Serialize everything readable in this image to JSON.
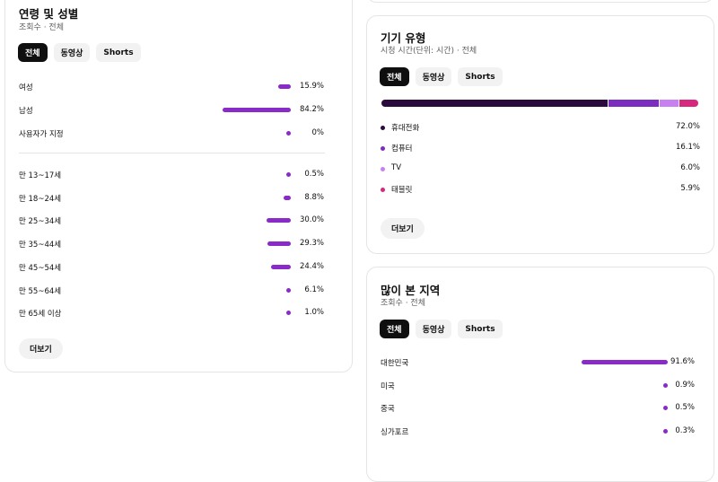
{
  "age_gender": {
    "title": "연령 및 성별",
    "subtitle": "조회수 · 전체",
    "chips": [
      "전체",
      "동영상",
      "Shorts"
    ],
    "gender_rows": [
      {
        "label": "여성",
        "value": "15.9%",
        "fraction": 0.159
      },
      {
        "label": "남성",
        "value": "84.2%",
        "fraction": 0.842
      },
      {
        "label": "사용자가 지정",
        "value": "0%",
        "fraction": 0.0
      }
    ],
    "age_rows": [
      {
        "label": "만 13~17세",
        "value": "0.5%",
        "fraction": 0.005
      },
      {
        "label": "만 18~24세",
        "value": "8.8%",
        "fraction": 0.088
      },
      {
        "label": "만 25~34세",
        "value": "30.0%",
        "fraction": 0.3
      },
      {
        "label": "만 35~44세",
        "value": "29.3%",
        "fraction": 0.293
      },
      {
        "label": "만 45~54세",
        "value": "24.4%",
        "fraction": 0.244
      },
      {
        "label": "만 55~64세",
        "value": "6.1%",
        "fraction": 0.061
      },
      {
        "label": "만 65세 이상",
        "value": "1.0%",
        "fraction": 0.01
      }
    ],
    "more_label": "더보기"
  },
  "device": {
    "title": "기기 유형",
    "subtitle": "시청 시간(단위: 시간) · 전체",
    "chips": [
      "전체",
      "동영상",
      "Shorts"
    ],
    "items": [
      {
        "label": "휴대전화",
        "value": "72.0%",
        "fraction": 0.72,
        "color": "#2b0a3d"
      },
      {
        "label": "컴퓨터",
        "value": "16.1%",
        "fraction": 0.161,
        "color": "#7b2dbf"
      },
      {
        "label": "TV",
        "value": "6.0%",
        "fraction": 0.06,
        "color": "#c77ff2"
      },
      {
        "label": "태블릿",
        "value": "5.9%",
        "fraction": 0.059,
        "color": "#d6287f"
      }
    ],
    "more_label": "더보기"
  },
  "geo": {
    "title": "많이 본 지역",
    "subtitle": "조회수 · 전체",
    "chips": [
      "전체",
      "동영상",
      "Shorts"
    ],
    "rows": [
      {
        "label": "대한민국",
        "value": "91.6%",
        "fraction": 0.916
      },
      {
        "label": "미국",
        "value": "0.9%",
        "fraction": 0.009
      },
      {
        "label": "중국",
        "value": "0.5%",
        "fraction": 0.005
      },
      {
        "label": "싱가포르",
        "value": "0.3%",
        "fraction": 0.003
      }
    ]
  },
  "colors": {
    "bar": "#8a2bc8",
    "chip_active_bg": "#0f0f0f"
  }
}
